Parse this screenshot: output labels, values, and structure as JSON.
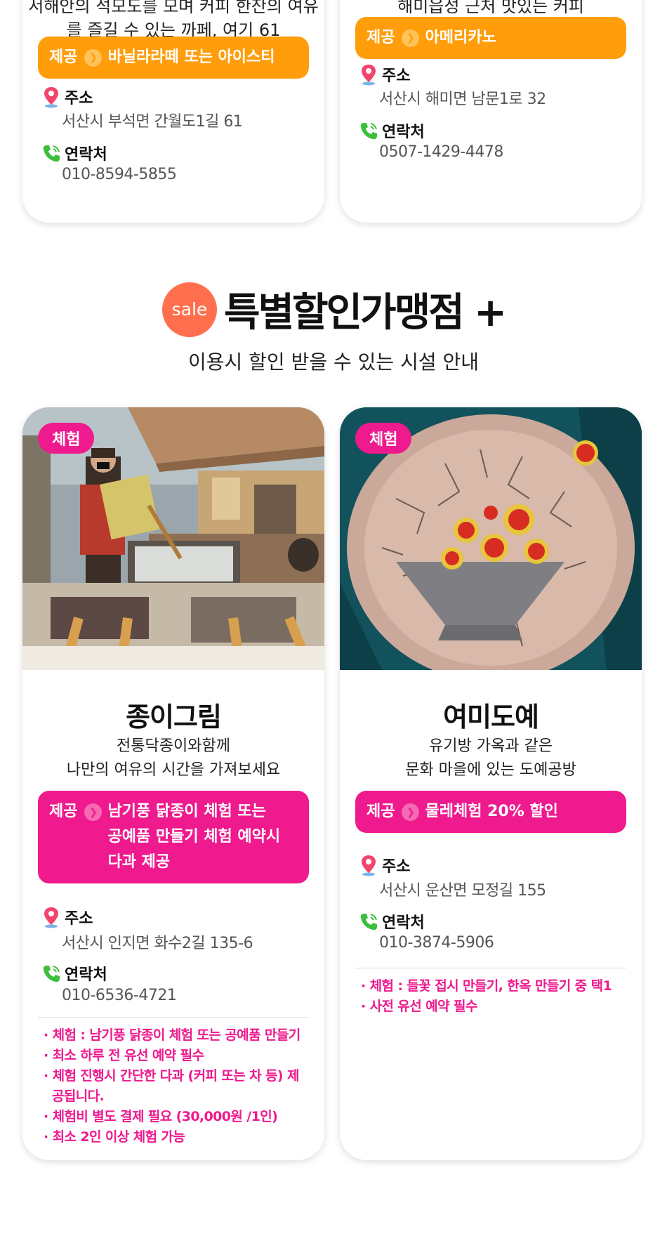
{
  "top_cards": [
    {
      "desc_line1": "서해안의 석모도를 모며 커피 한잔의 여유",
      "desc_line2": "를 즐길 수 있는 까페, 여기 61",
      "offer_label": "제공",
      "offer_text": "바닐라라떼 또는 아이스티",
      "address_label": "주소",
      "address": "서산시 부석면 간월도1길 61",
      "contact_label": "연락처",
      "phone": "010-8594-5855"
    },
    {
      "desc_line1": "해미읍성 근처 맛있는 커피",
      "offer_label": "제공",
      "offer_text": "아메리카노",
      "address_label": "주소",
      "address": "서산시 해미면 남문1로 32",
      "contact_label": "연락처",
      "phone": "0507-1429-4478"
    }
  ],
  "section": {
    "sale_badge": "sale",
    "title": "특별할인가맹점 +",
    "subtitle": "이용시 할인 받을 수 있는 시설 안내"
  },
  "places": [
    {
      "badge": "체험",
      "name": "종이그림",
      "desc_line1": "전통닥종이와함께",
      "desc_line2": "나만의 여유의 시간을 가져보세요",
      "offer_label": "제공",
      "offer_lines": [
        "남기풍 닭종이 체험 또는",
        "공예품 만들기 체험 예약시",
        "다과 제공"
      ],
      "address_label": "주소",
      "address": "서산시 인지면 화수2길 135-6",
      "contact_label": "연락처",
      "phone": "010-6536-4721",
      "notes": [
        "· 체험 : 남기풍 닭종이 체험 또는 공예품 만들기",
        "· 최소 하루 전 유선 예약 필수",
        "· 체험 진행시 간단한 다과 (커피 또는 차 등) 제공됩니다.",
        "· 체험비 별도 결제 필요 (30,000원 /1인)",
        "· 최소 2인 이상 체험 가능"
      ]
    },
    {
      "badge": "체험",
      "name": "여미도예",
      "desc_line1": "유기방 가옥과 같은",
      "desc_line2": "문화 마을에 있는 도예공방",
      "offer_label": "제공",
      "offer_lines": [
        "물레체험 20% 할인"
      ],
      "address_label": "주소",
      "address": "서산시 운산면 모정길 155",
      "contact_label": "연락처",
      "phone": "010-3874-5906",
      "notes": [
        "· 체험 : 들꽃 접시 만들기, 한옥 만들기 중 택1",
        "· 사전 유선 예약 필수"
      ]
    }
  ],
  "icons": {
    "location": "location-pin-icon",
    "phone": "phone-icon",
    "arrow": "chevron-right-icon"
  },
  "colors": {
    "orange": "#ff9d0a",
    "pink": "#ee1a8e",
    "sale": "#ff6f4e"
  }
}
